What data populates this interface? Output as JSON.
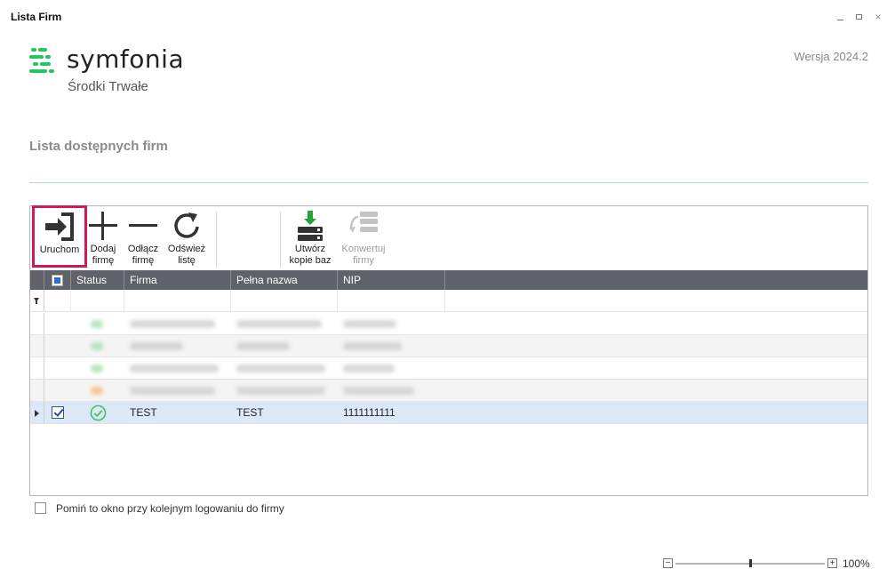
{
  "window": {
    "title": "Lista Firm",
    "controls": {
      "minimize": "minimize-icon",
      "maximize": "maximize-icon",
      "close": "×"
    }
  },
  "branding": {
    "logo_word": "symfonia",
    "product": "Środki Trwałe",
    "version": "Wersja 2024.2",
    "logo_color": "#22c55e"
  },
  "section": {
    "title": "Lista dostępnych firm"
  },
  "toolbar": {
    "run": {
      "label": "Uruchom",
      "icon": "login-arrow-icon"
    },
    "add": {
      "label": "Dodaj\nfirmę",
      "icon": "plus-icon"
    },
    "detach": {
      "label": "Odłącz\nfirmę",
      "icon": "minus-icon"
    },
    "refresh": {
      "label": "Odśwież\nlistę",
      "icon": "refresh-icon"
    },
    "backup": {
      "label": "Utwórz\nkopie baz",
      "icon": "database-download-icon"
    },
    "convert": {
      "label": "Konwertuj\nfirmy",
      "icon": "database-convert-icon",
      "disabled": true
    }
  },
  "grid": {
    "columns": [
      "Status",
      "Firma",
      "Pełna nazwa",
      "NIP"
    ],
    "rows": [
      {
        "status": "ok",
        "firma": "TEST",
        "pelna_nazwa": "TEST",
        "nip": "1111111111",
        "checked": true,
        "selected": true
      }
    ]
  },
  "footer": {
    "skip_label": "Pomiń to okno przy kolejnym logowaniu do firmy",
    "skip_checked": false
  },
  "zoom": {
    "minus": "−",
    "plus": "+",
    "level": "100%"
  },
  "colors": {
    "accent_highlight": "#d1185a",
    "header_bg": "#60626b",
    "selected_row": "#dce8f8",
    "status_ok": "#3fbf5f",
    "status_warning": "#f5a24b"
  }
}
